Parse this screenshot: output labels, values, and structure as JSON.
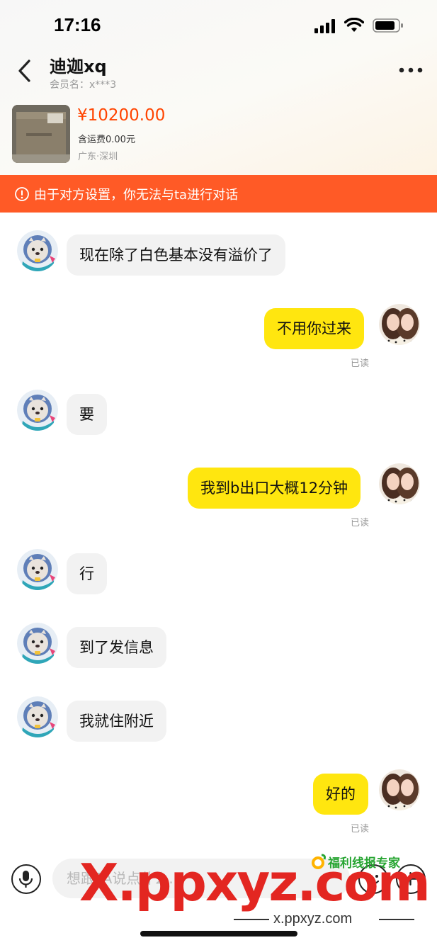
{
  "status_bar": {
    "time": "17:16"
  },
  "header": {
    "name": "迪迦xq",
    "member_line": "会员名：x***3"
  },
  "product": {
    "price": "¥10200.00",
    "shipping": "含运费0.00元",
    "location": "广东·深圳"
  },
  "notice": {
    "text": "由于对方设置，你无法与ta进行对话"
  },
  "messages": [
    {
      "from": "them",
      "text": "现在除了白色基本没有溢价了"
    },
    {
      "from": "me",
      "text": "不用你过来",
      "status": "已读"
    },
    {
      "from": "them",
      "text": "要"
    },
    {
      "from": "me",
      "text": "我到b出口大概12分钟",
      "status": "已读"
    },
    {
      "from": "them",
      "text": "行"
    },
    {
      "from": "them",
      "text": "到了发信息"
    },
    {
      "from": "them",
      "text": "我就住附近"
    },
    {
      "from": "me",
      "text": "好的",
      "status": "已读"
    }
  ],
  "input": {
    "placeholder": "想跟TA说点什么..."
  },
  "watermark": {
    "main": "X.ppxyz.com",
    "sub": "x.ppxyz.com",
    "brand": "福利线报专家"
  },
  "colors": {
    "accent_orange": "#ff5a26",
    "price": "#ff4400",
    "bubble_out": "#ffe60f",
    "bubble_in": "#f2f2f2",
    "watermark_red": "#e32621",
    "watermark_green": "#27a532"
  },
  "icons": [
    "back-arrow-icon",
    "more-dots-icon",
    "warning-circle-icon",
    "voice-icon",
    "emoji-icon",
    "plus-icon",
    "signal-icon",
    "wifi-icon",
    "battery-icon"
  ]
}
